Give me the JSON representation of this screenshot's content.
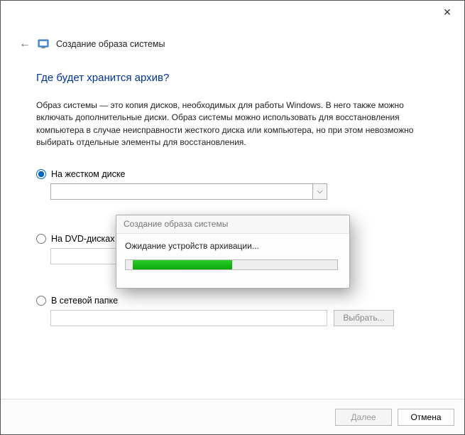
{
  "header": {
    "title": "Создание образа системы"
  },
  "question": "Где будет хранится архив?",
  "description": "Образ системы — это копия дисков, необходимых для работы Windows. В него также можно включать дополнительные диски. Образ системы можно использовать для восстановления компьютера в случае неисправности жесткого диска или компьютера, но при этом невозможно выбирать отдельные элементы для восстановления.",
  "options": {
    "hdd": {
      "label": "На жестком диске"
    },
    "dvd": {
      "label": "На DVD-дисках"
    },
    "net": {
      "label": "В сетевой папке",
      "choose_btn": "Выбрать..."
    }
  },
  "footer": {
    "next": "Далее",
    "cancel": "Отмена"
  },
  "popup": {
    "title": "Создание образа системы",
    "message": "Ожидание устройств архивации...",
    "progress_percent": 45
  }
}
